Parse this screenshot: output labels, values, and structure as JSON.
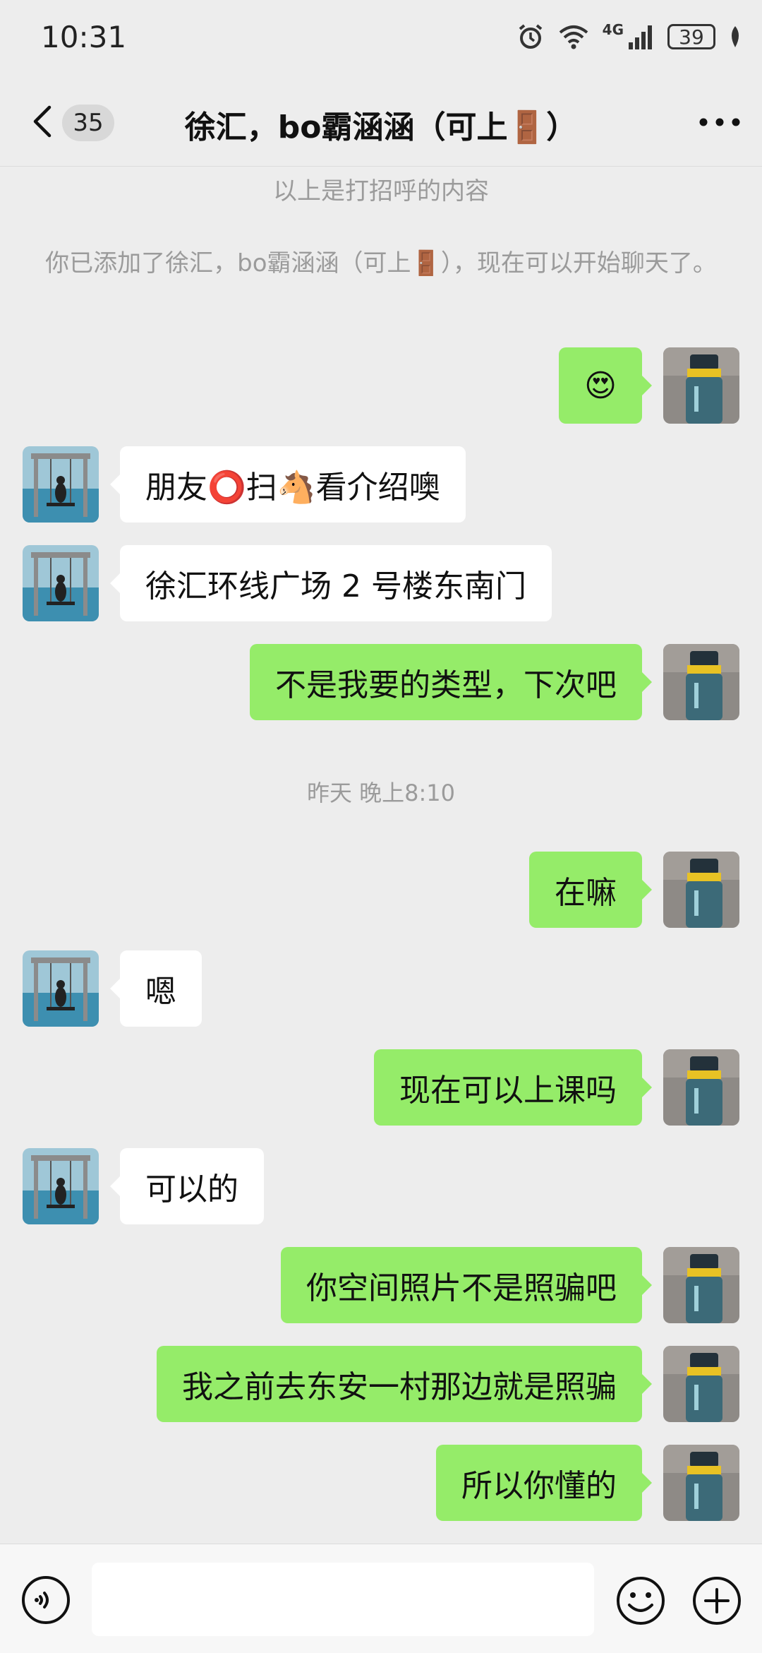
{
  "status_bar": {
    "time": "10:31",
    "network": "4G",
    "battery": "39"
  },
  "header": {
    "unread_count": "35",
    "title": "徐汇，bo霸涵涵（可上🚪）"
  },
  "chat": {
    "system_1": "以上是打招呼的内容",
    "system_2": "你已添加了徐汇，bo霸涵涵（可上🚪），现在可以开始聊天了。",
    "time_separator": "昨天 晚上8:10",
    "messages": [
      {
        "side": "right",
        "text": "😍"
      },
      {
        "side": "left",
        "text": "朋友⭕扫🐴看介绍噢"
      },
      {
        "side": "left",
        "text": "徐汇环线广场 2 号楼东南门"
      },
      {
        "side": "right",
        "text": "不是我要的类型，下次吧"
      },
      {
        "side": "right",
        "text": "在嘛"
      },
      {
        "side": "left",
        "text": "嗯"
      },
      {
        "side": "right",
        "text": "现在可以上课吗"
      },
      {
        "side": "left",
        "text": "可以的"
      },
      {
        "side": "right",
        "text": "你空间照片不是照骗吧"
      },
      {
        "side": "right",
        "text": "我之前去东安一村那边就是照骗"
      },
      {
        "side": "right",
        "text": "所以你懂的"
      }
    ]
  },
  "input_bar": {
    "placeholder": ""
  },
  "colors": {
    "background": "#ededed",
    "sent_bubble": "#95ec69",
    "received_bubble": "#ffffff"
  }
}
